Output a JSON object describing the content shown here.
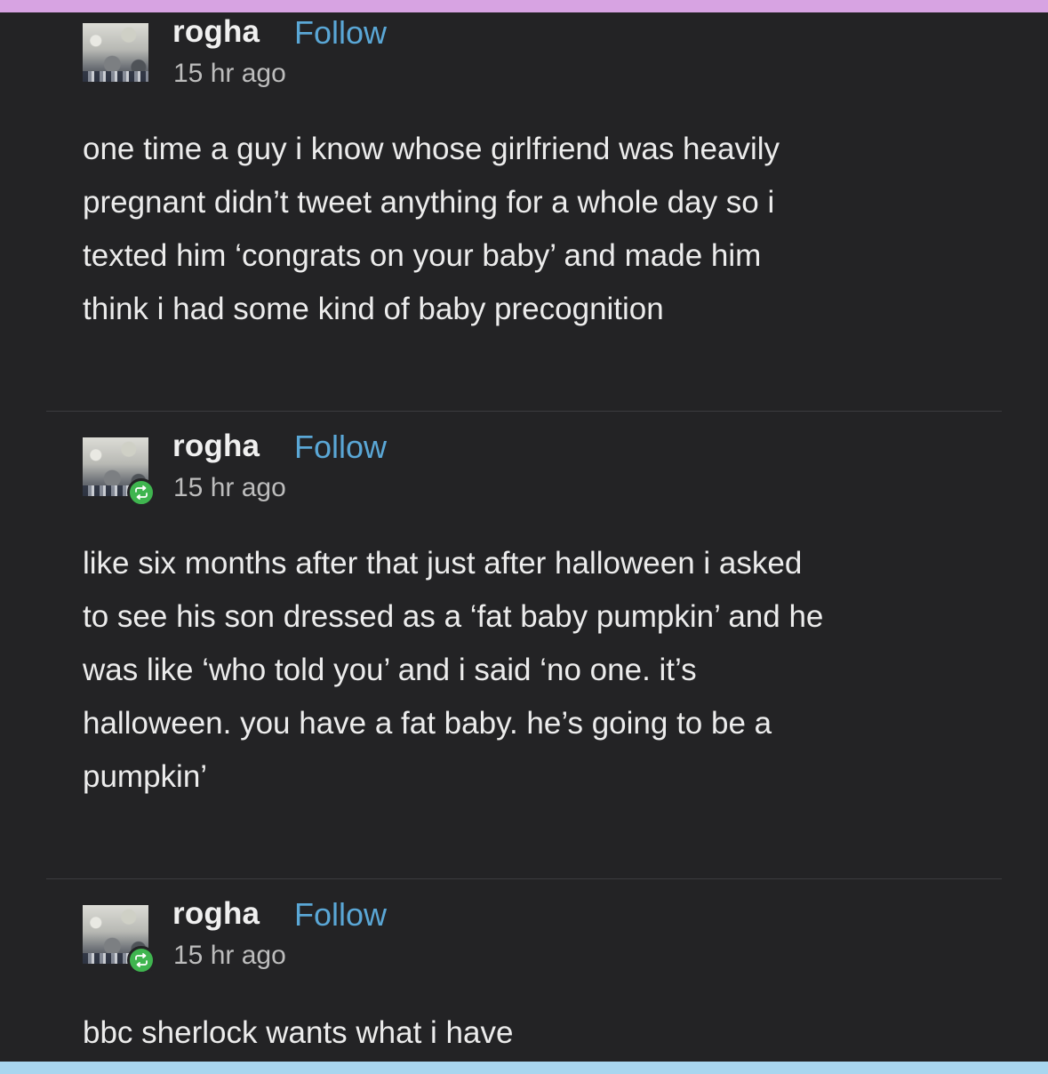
{
  "colors": {
    "background": "#232325",
    "follow_link": "#5aa7d6",
    "reblog_badge": "#3fb54f",
    "top_border": "#d7a3e2",
    "bottom_border": "#a9d6ef"
  },
  "posts": [
    {
      "username": "rogha",
      "follow_label": "Follow",
      "timestamp": "15 hr ago",
      "reblog_icon": false,
      "text": "one time a guy i know whose girlfriend was heavily\npregnant didn’t tweet anything for a whole day so i\ntexted him ‘congrats on your baby’ and made him\nthink i had some kind of baby precognition"
    },
    {
      "username": "rogha",
      "follow_label": "Follow",
      "timestamp": "15 hr ago",
      "reblog_icon": true,
      "text": "like six months after that just after halloween i asked\nto see his son dressed as a ‘fat baby pumpkin’ and he\nwas like ‘who told you’ and i said ‘no one. it’s\nhalloween. you have a fat baby. he’s going to be a\npumpkin’"
    },
    {
      "username": "rogha",
      "follow_label": "Follow",
      "timestamp": "15 hr ago",
      "reblog_icon": true,
      "text": "bbc sherlock wants what i have"
    }
  ]
}
